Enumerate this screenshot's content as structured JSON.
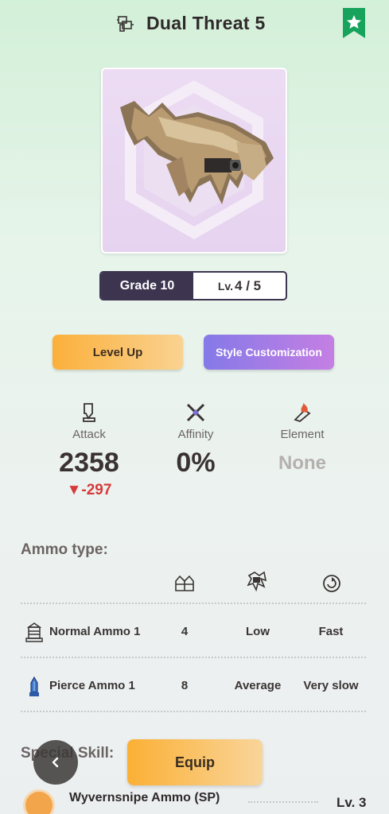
{
  "header": {
    "title": "Dual Threat 5",
    "weapon_type_icon": "bowgun-icon",
    "bookmark_icon": "star-bookmark-icon"
  },
  "grade": {
    "label": "Grade 10",
    "level_label": "Lv.",
    "level_value": "4 / 5"
  },
  "actions": {
    "level_up": "Level Up",
    "style_customization": "Style Customization"
  },
  "stats": {
    "attack": {
      "label": "Attack",
      "value": "2358",
      "delta": "▼-297",
      "icon": "sword-icon"
    },
    "affinity": {
      "label": "Affinity",
      "value": "0%",
      "icon": "crossed-blades-icon"
    },
    "element": {
      "label": "Element",
      "value": "None",
      "icon": "flame-blade-icon"
    }
  },
  "ammo": {
    "title": "Ammo type:",
    "column_icons": [
      "capacity-icon",
      "recoil-icon",
      "reload-icon"
    ],
    "rows": [
      {
        "name": "Normal Ammo 1",
        "capacity": "4",
        "recoil": "Low",
        "reload": "Fast",
        "icon": "normal-ammo-icon"
      },
      {
        "name": "Pierce Ammo 1",
        "capacity": "8",
        "recoil": "Average",
        "reload": "Very slow",
        "icon": "pierce-ammo-icon"
      }
    ]
  },
  "special_skill": {
    "title": "Special Skill:",
    "name": "Wyvernsnipe Ammo (SP)",
    "level": "Lv. 3"
  },
  "bottom": {
    "equip": "Equip",
    "back_icon": "chevron-left-icon"
  },
  "colors": {
    "primary_button": "#fbb03b",
    "style_button": "#8579e8",
    "grade_dark": "#3d3450",
    "delta_red": "#d63a3a"
  }
}
